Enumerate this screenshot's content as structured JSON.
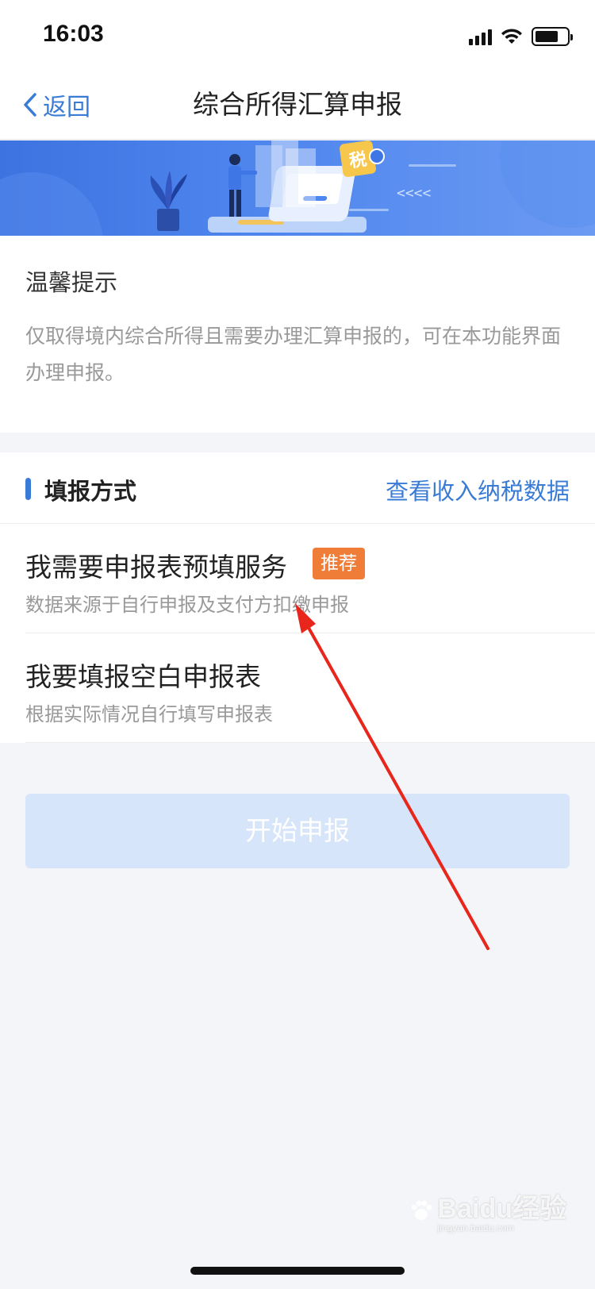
{
  "status_bar": {
    "time": "16:03"
  },
  "nav": {
    "back_label": "返回",
    "title": "综合所得汇算申报"
  },
  "banner": {
    "tax_badge": "税",
    "arrows": "<<<<"
  },
  "tips": {
    "title": "温馨提示",
    "text": "仅取得境内综合所得且需要办理汇算申报的，可在本功能界面办理申报。"
  },
  "method": {
    "title": "填报方式",
    "link": "查看收入纳税数据",
    "options": [
      {
        "title": "我需要申报表预填服务",
        "badge": "推荐",
        "subtitle": "数据来源于自行申报及支付方扣缴申报"
      },
      {
        "title": "我要填报空白申报表",
        "subtitle": "根据实际情况自行填写申报表"
      }
    ]
  },
  "start_button": {
    "label": "开始申报"
  },
  "watermark": {
    "brand": "Baidu经验",
    "url": "jingyan.baidu.com"
  },
  "colors": {
    "accent": "#3a7bd5",
    "badge": "#ef7d37",
    "button_disabled": "#d6e5fa"
  }
}
